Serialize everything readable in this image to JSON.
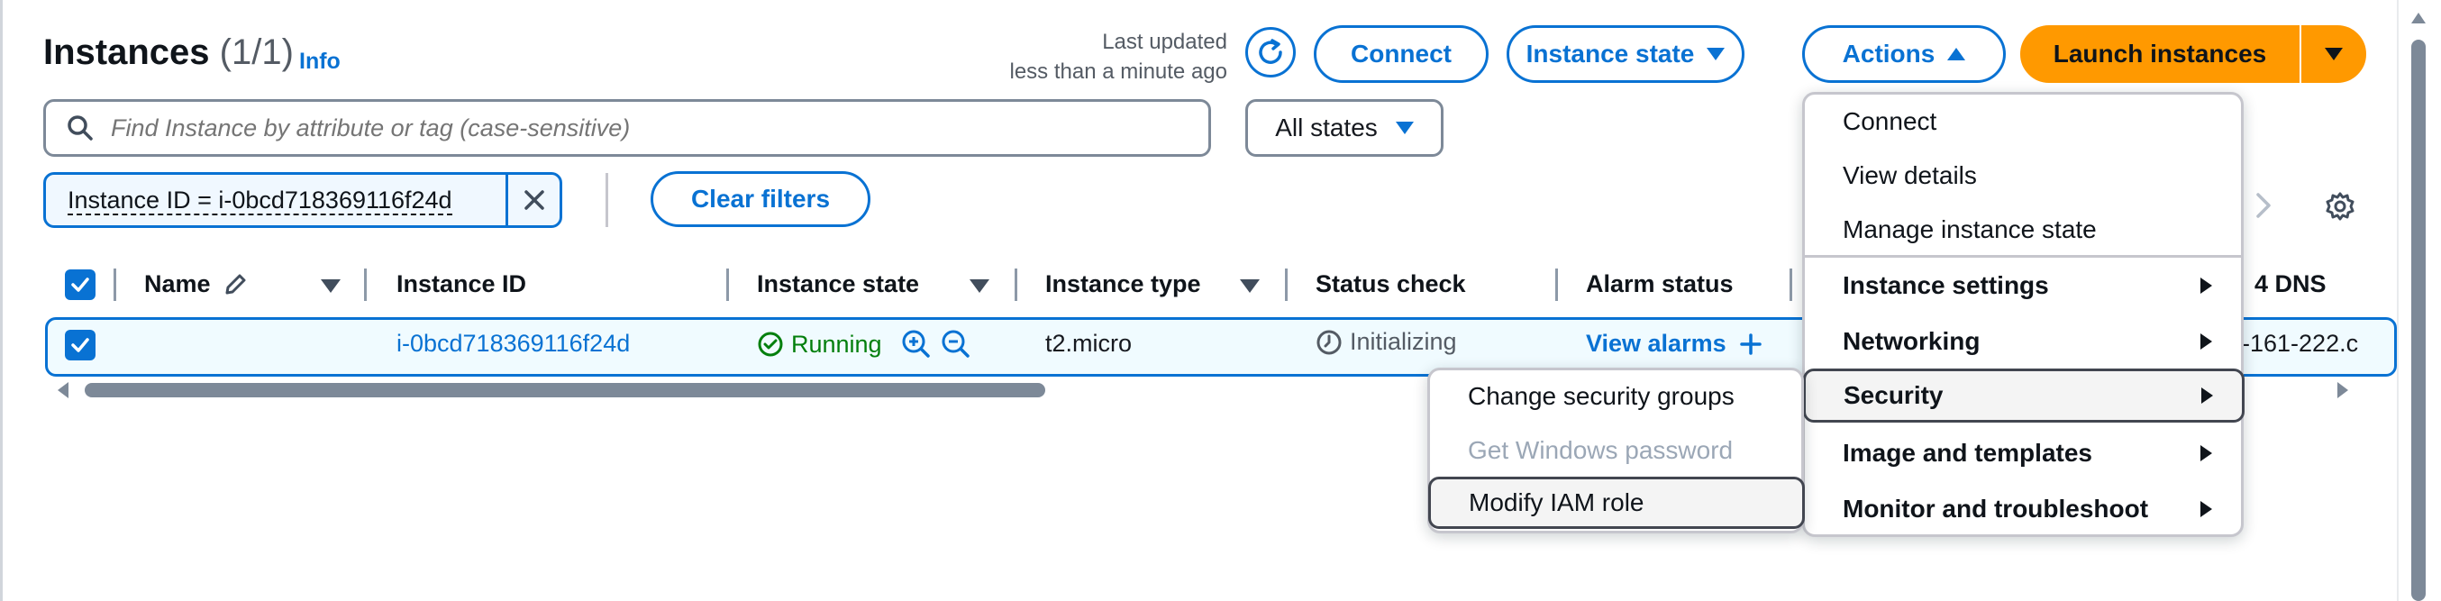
{
  "header": {
    "title": "Instances",
    "count": "(1/1)",
    "info": "Info",
    "last_updated_line1": "Last updated",
    "last_updated_line2": "less than a minute ago"
  },
  "toolbar": {
    "connect": "Connect",
    "instance_state": "Instance state",
    "actions": "Actions",
    "launch": "Launch instances"
  },
  "search": {
    "placeholder": "Find Instance by attribute or tag (case-sensitive)",
    "states_select": "All states"
  },
  "filter": {
    "token": "Instance ID = i-0bcd718369116f24d",
    "clear": "Clear filters"
  },
  "table": {
    "columns": [
      "Name",
      "Instance ID",
      "Instance state",
      "Instance type",
      "Status check",
      "Alarm status",
      "4 DNS"
    ],
    "row": {
      "name": "",
      "instance_id": "i-0bcd718369116f24d",
      "state": "Running",
      "type": "t2.micro",
      "status_check": "Initializing",
      "alarm": "View alarms",
      "dns_partial": "-161-222.c"
    }
  },
  "actions_menu": {
    "items": [
      "Connect",
      "View details",
      "Manage instance state",
      "Instance settings",
      "Networking",
      "Security",
      "Image and templates",
      "Monitor and troubleshoot"
    ]
  },
  "security_submenu": {
    "items": [
      "Change security groups",
      "Get Windows password",
      "Modify IAM role"
    ]
  },
  "colors": {
    "accent": "#0972d3",
    "primary": "#ff9900",
    "success": "#037f0c"
  }
}
